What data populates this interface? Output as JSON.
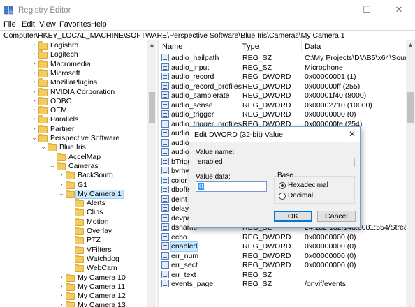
{
  "window": {
    "title": "Registry Editor",
    "minimize_icon": "—",
    "maximize_icon": "☐",
    "close_icon": "✕"
  },
  "menu": [
    "File",
    "Edit",
    "View",
    "Favorites",
    "Help"
  ],
  "address": "Computer\\HKEY_LOCAL_MACHINE\\SOFTWARE\\Perspective Software\\Blue Iris\\Cameras\\My Camera 1",
  "tree": [
    {
      "label": "Logishrd",
      "level": 0,
      "expander": "›"
    },
    {
      "label": "Logitech",
      "level": 0,
      "expander": "›"
    },
    {
      "label": "Macromedia",
      "level": 0,
      "expander": "›"
    },
    {
      "label": "Microsoft",
      "level": 0,
      "expander": "›"
    },
    {
      "label": "MozillaPlugins",
      "level": 0,
      "expander": "›"
    },
    {
      "label": "NVIDIA Corporation",
      "level": 0,
      "expander": "›"
    },
    {
      "label": "ODBC",
      "level": 0,
      "expander": "›"
    },
    {
      "label": "OEM",
      "level": 0,
      "expander": "›"
    },
    {
      "label": "Parallels",
      "level": 0,
      "expander": "›"
    },
    {
      "label": "Partner",
      "level": 0,
      "expander": "›"
    },
    {
      "label": "Perspective Software",
      "level": 0,
      "expander": "⌄"
    },
    {
      "label": "Blue Iris",
      "level": 1,
      "expander": "⌄"
    },
    {
      "label": "AccelMap",
      "level": 2,
      "expander": ""
    },
    {
      "label": "Cameras",
      "level": 2,
      "expander": "⌄"
    },
    {
      "label": "BackSouth",
      "level": 3,
      "expander": "›"
    },
    {
      "label": "G1",
      "level": 3,
      "expander": "›"
    },
    {
      "label": "My Camera 1",
      "level": 3,
      "expander": "⌄",
      "selected": true
    },
    {
      "label": "Alerts",
      "level": 4,
      "expander": ""
    },
    {
      "label": "Clips",
      "level": 4,
      "expander": ""
    },
    {
      "label": "Motion",
      "level": 4,
      "expander": ""
    },
    {
      "label": "Overlay",
      "level": 4,
      "expander": ""
    },
    {
      "label": "PTZ",
      "level": 4,
      "expander": ""
    },
    {
      "label": "VFilters",
      "level": 4,
      "expander": ""
    },
    {
      "label": "Watchdog",
      "level": 4,
      "expander": ""
    },
    {
      "label": "WebCam",
      "level": 4,
      "expander": ""
    },
    {
      "label": "My Camera 10",
      "level": 3,
      "expander": "›"
    },
    {
      "label": "My Camera 11",
      "level": 3,
      "expander": "›"
    },
    {
      "label": "My Camera 12",
      "level": 3,
      "expander": "›"
    },
    {
      "label": "My Camera 13",
      "level": 3,
      "expander": "›"
    }
  ],
  "list": {
    "columns": [
      "Name",
      "Type",
      "Data"
    ],
    "rows": [
      {
        "name": "audio_hailpath",
        "type": "REG_SZ",
        "data": "C:\\My Projects\\DV\\B5\\x64\\Sounds\\ha"
      },
      {
        "name": "audio_input",
        "type": "REG_SZ",
        "data": "Microphone"
      },
      {
        "name": "audio_record",
        "type": "REG_DWORD",
        "data": "0x00000001 (1)"
      },
      {
        "name": "audio_record_profiles",
        "type": "REG_DWORD",
        "data": "0x000000ff (255)"
      },
      {
        "name": "audio_samplerate",
        "type": "REG_DWORD",
        "data": "0x00001f40 (8000)"
      },
      {
        "name": "audio_sense",
        "type": "REG_DWORD",
        "data": "0x00002710 (10000)"
      },
      {
        "name": "audio_trigger",
        "type": "REG_DWORD",
        "data": "0x00000000 (0)"
      },
      {
        "name": "audio_trigger_profiles",
        "type": "REG_DWORD",
        "data": "0x000000fe (254)"
      },
      {
        "name": "audio_",
        "type": "",
        "data": ""
      },
      {
        "name": "audio_",
        "type": "",
        "data": ""
      },
      {
        "name": "audio_",
        "type": "",
        "data": ""
      },
      {
        "name": "bTrigge",
        "type": "",
        "data": ""
      },
      {
        "name": "bvrhw",
        "type": "",
        "data": ""
      },
      {
        "name": "color",
        "type": "",
        "data": "0"
      },
      {
        "name": "dboffse",
        "type": "",
        "data": ""
      },
      {
        "name": "deint",
        "type": "",
        "data": ""
      },
      {
        "name": "delay",
        "type": "",
        "data": ""
      },
      {
        "name": "devpat",
        "type": "",
        "data": ""
      },
      {
        "name": "dsname",
        "type": "REG_SZ",
        "data": "24.182.132.148:8081:554/Streaming/C"
      },
      {
        "name": "echo",
        "type": "REG_DWORD",
        "data": "0x00000000 (0)"
      },
      {
        "name": "enabled",
        "type": "REG_DWORD",
        "data": "0x00000000 (0)",
        "selected": true
      },
      {
        "name": "err_num",
        "type": "REG_DWORD",
        "data": "0x00000000 (0)"
      },
      {
        "name": "err_sect",
        "type": "REG_DWORD",
        "data": "0x00000000 (0)"
      },
      {
        "name": "err_text",
        "type": "REG_SZ",
        "data": ""
      },
      {
        "name": "events_page",
        "type": "REG_SZ",
        "data": "/onvif/events"
      }
    ]
  },
  "dialog": {
    "title": "Edit DWORD (32-bit) Value",
    "close_icon": "✕",
    "value_name_label": "Value name:",
    "value_name": "enabled",
    "value_data_label": "Value data:",
    "value_data": "0",
    "base_label": "Base",
    "base_options": [
      {
        "label": "Hexadecimal",
        "checked": true
      },
      {
        "label": "Decimal",
        "checked": false
      }
    ],
    "ok_label": "OK",
    "cancel_label": "Cancel"
  },
  "scroll": {
    "up_icon": "▲"
  }
}
